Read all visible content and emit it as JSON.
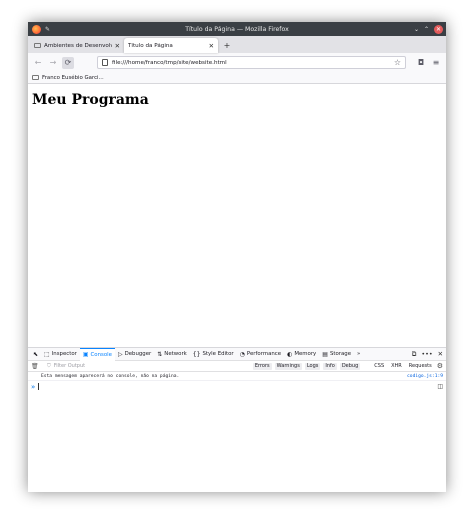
{
  "window": {
    "title": "Título da Página — Mozilla Firefox",
    "controls": {
      "minimize": "⌄",
      "maximize": "⌃",
      "close": "✕"
    }
  },
  "tabs": [
    {
      "label": "Ambientes de Desenvolvimen",
      "active": false
    },
    {
      "label": "Título da Página",
      "active": true
    }
  ],
  "tab_close_glyph": "✕",
  "new_tab_glyph": "+",
  "navbar": {
    "back": "←",
    "forward": "→",
    "reload": "⟳",
    "url": "file:///home/franco/tmp/site/website.html",
    "star": "☆",
    "pocket": "◘",
    "menu": "≡"
  },
  "bookmarks": [
    {
      "label": "Franco Eusébio Garci..."
    }
  ],
  "page": {
    "heading": "Meu Programa"
  },
  "devtools": {
    "tabs": [
      {
        "icon": "⬚",
        "label": "Inspector"
      },
      {
        "icon": "▣",
        "label": "Console",
        "active": true
      },
      {
        "icon": "▷",
        "label": "Debugger"
      },
      {
        "icon": "⇅",
        "label": "Network"
      },
      {
        "icon": "{}",
        "label": "Style Editor"
      },
      {
        "icon": "◔",
        "label": "Performance"
      },
      {
        "icon": "◐",
        "label": "Memory"
      },
      {
        "icon": "▤",
        "label": "Storage"
      }
    ],
    "overflow": "»",
    "right_icons": {
      "dock": "⧉",
      "more": "•••",
      "close": "✕"
    },
    "filter": {
      "placeholder": "Filter Output",
      "levels": [
        "Errors",
        "Warnings",
        "Logs",
        "Info",
        "Debug"
      ],
      "types": [
        "CSS",
        "XHR",
        "Requests"
      ]
    },
    "console": {
      "message": "Esta mensagem aparecerá no console, não na página.",
      "source": "codigo.js:1:9",
      "prompt": "»"
    }
  }
}
